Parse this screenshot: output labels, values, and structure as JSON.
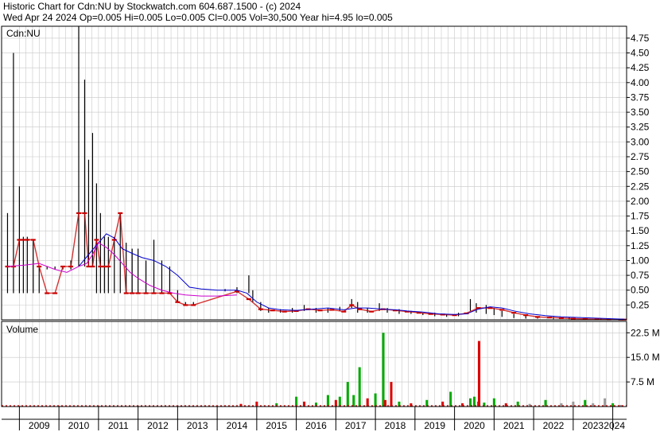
{
  "header": {
    "title_line": "Historic Chart for Cdn:NU by Stockwatch.com 604.687.1500 - (c) 2024",
    "summary_line": "Wed Apr 24 2024   Op=0.005  Hi=0.005  Lo=0.005  Cl=0.005  Vol=30,500  Year hi=4.95  lo=0.005"
  },
  "chart_data": [
    {
      "type": "line",
      "title": "Cdn:NU",
      "ylim": [
        0,
        4.95
      ],
      "y_ticks": [
        "0.25",
        "0.50",
        "0.75",
        "1.00",
        "1.25",
        "1.50",
        "1.75",
        "2.00",
        "2.25",
        "2.50",
        "2.75",
        "3.00",
        "3.25",
        "3.50",
        "3.75",
        "4.00",
        "4.25",
        "4.50",
        "4.75"
      ],
      "x_ticks": [
        "2009",
        "2010",
        "2011",
        "2012",
        "2013",
        "2014",
        "2015",
        "2016",
        "2017",
        "2018",
        "2019",
        "2020",
        "2021",
        "2022",
        "2023",
        "2024"
      ],
      "grid": true,
      "series": [
        {
          "kind": "price-bars",
          "color": "#000000",
          "x": [
            2008.7,
            2008.85,
            2009.0,
            2009.1,
            2009.2,
            2009.35,
            2009.5,
            2009.7,
            2009.9,
            2010.1,
            2010.3,
            2010.5,
            2010.65,
            2010.75,
            2010.85,
            2010.95,
            2011.05,
            2011.15,
            2011.25,
            2011.4,
            2011.55,
            2011.7,
            2011.85,
            2012.0,
            2012.2,
            2012.4,
            2012.6,
            2012.8,
            2013.0,
            2013.2,
            2013.4,
            2014.2,
            2014.5,
            2014.8,
            2014.9,
            2015.1,
            2015.3,
            2015.6,
            2015.9,
            2016.2,
            2016.5,
            2016.8,
            2017.1,
            2017.4,
            2017.55,
            2017.8,
            2018.1,
            2018.3,
            2018.6,
            2018.9,
            2019.2,
            2019.5,
            2019.8,
            2020.1,
            2020.4,
            2020.55,
            2020.8,
            2021.0,
            2021.2,
            2021.5,
            2021.8,
            2022.1,
            2022.5,
            2022.9,
            2023.3,
            2023.7,
            2024.1,
            2024.3
          ],
          "high": [
            1.8,
            4.5,
            2.25,
            1.4,
            1.4,
            1.35,
            0.9,
            0.9,
            0.9,
            0.9,
            1.0,
            4.95,
            4.05,
            2.7,
            3.15,
            2.3,
            1.8,
            1.4,
            1.4,
            1.4,
            1.8,
            1.3,
            1.2,
            1.2,
            1.0,
            1.35,
            1.0,
            0.9,
            0.5,
            0.3,
            0.3,
            0.52,
            0.55,
            0.75,
            0.5,
            0.3,
            0.2,
            0.18,
            0.2,
            0.25,
            0.2,
            0.2,
            0.22,
            0.35,
            0.3,
            0.2,
            0.28,
            0.2,
            0.18,
            0.15,
            0.12,
            0.12,
            0.1,
            0.12,
            0.35,
            0.28,
            0.25,
            0.2,
            0.15,
            0.1,
            0.08,
            0.06,
            0.05,
            0.04,
            0.03,
            0.02,
            0.01,
            0.005
          ],
          "low": [
            0.45,
            0.45,
            0.45,
            0.45,
            0.45,
            0.45,
            0.45,
            0.85,
            0.85,
            0.85,
            0.85,
            0.9,
            0.9,
            0.9,
            0.9,
            0.45,
            0.45,
            0.45,
            0.45,
            0.45,
            0.45,
            0.45,
            0.45,
            0.45,
            0.45,
            0.45,
            0.45,
            0.45,
            0.3,
            0.25,
            0.25,
            0.48,
            0.45,
            0.45,
            0.3,
            0.15,
            0.12,
            0.12,
            0.12,
            0.15,
            0.12,
            0.12,
            0.15,
            0.2,
            0.12,
            0.12,
            0.15,
            0.12,
            0.1,
            0.1,
            0.08,
            0.06,
            0.05,
            0.06,
            0.15,
            0.12,
            0.1,
            0.08,
            0.05,
            0.03,
            0.02,
            0.02,
            0.01,
            0.01,
            0.005,
            0.005,
            0.005,
            0.005
          ]
        },
        {
          "kind": "price-close",
          "color": "#cc0000",
          "x": [
            2008.7,
            2008.85,
            2009.0,
            2009.1,
            2009.2,
            2009.35,
            2009.5,
            2009.7,
            2009.9,
            2010.1,
            2010.3,
            2010.5,
            2010.65,
            2010.75,
            2010.85,
            2010.95,
            2011.05,
            2011.15,
            2011.25,
            2011.4,
            2011.55,
            2011.7,
            2011.85,
            2012.0,
            2012.2,
            2012.4,
            2012.6,
            2012.8,
            2013.0,
            2013.2,
            2013.4,
            2014.5,
            2014.8,
            2015.1,
            2015.4,
            2015.7,
            2016.0,
            2016.3,
            2016.6,
            2016.9,
            2017.2,
            2017.4,
            2017.6,
            2017.9,
            2018.2,
            2018.5,
            2018.8,
            2019.1,
            2019.4,
            2019.7,
            2020.0,
            2020.3,
            2020.6,
            2020.9,
            2021.2,
            2021.5,
            2021.8,
            2022.1,
            2022.4,
            2022.7,
            2023.0,
            2023.3,
            2023.6,
            2023.9,
            2024.2,
            2024.3
          ],
          "y": [
            0.9,
            0.9,
            1.35,
            1.35,
            1.35,
            1.35,
            0.9,
            0.45,
            0.45,
            0.9,
            0.9,
            1.8,
            1.8,
            0.9,
            0.9,
            1.35,
            0.9,
            0.9,
            0.9,
            1.35,
            1.8,
            0.45,
            0.45,
            0.45,
            0.45,
            0.45,
            0.45,
            0.45,
            0.3,
            0.25,
            0.25,
            0.48,
            0.35,
            0.18,
            0.16,
            0.14,
            0.15,
            0.18,
            0.16,
            0.17,
            0.14,
            0.25,
            0.18,
            0.14,
            0.18,
            0.16,
            0.14,
            0.12,
            0.1,
            0.09,
            0.08,
            0.11,
            0.2,
            0.2,
            0.17,
            0.12,
            0.08,
            0.05,
            0.04,
            0.03,
            0.02,
            0.015,
            0.01,
            0.008,
            0.005,
            0.005
          ]
        },
        {
          "kind": "moving-average",
          "color": "#0000cc",
          "x": [
            2010.5,
            2010.75,
            2011.0,
            2011.2,
            2011.4,
            2011.6,
            2011.85,
            2012.1,
            2012.4,
            2012.7,
            2013.0,
            2013.3,
            2013.6,
            2014.0,
            2014.5,
            2014.75,
            2015.0,
            2015.3,
            2015.6,
            2016.0,
            2016.4,
            2016.8,
            2017.2,
            2017.5,
            2017.8,
            2018.2,
            2018.5,
            2018.8,
            2019.2,
            2019.6,
            2020.0,
            2020.3,
            2020.6,
            2020.9,
            2021.2,
            2021.5,
            2021.9,
            2022.3,
            2022.7,
            2023.1,
            2023.5,
            2023.9,
            2024.3
          ],
          "y": [
            0.9,
            1.1,
            1.3,
            1.45,
            1.38,
            1.2,
            1.12,
            1.05,
            1.0,
            0.9,
            0.75,
            0.55,
            0.52,
            0.5,
            0.5,
            0.45,
            0.3,
            0.2,
            0.17,
            0.16,
            0.18,
            0.2,
            0.17,
            0.2,
            0.2,
            0.18,
            0.17,
            0.15,
            0.13,
            0.1,
            0.09,
            0.1,
            0.18,
            0.22,
            0.2,
            0.15,
            0.1,
            0.07,
            0.05,
            0.04,
            0.03,
            0.02,
            0.01
          ]
        },
        {
          "kind": "moving-average",
          "color": "#cc00cc",
          "x": [
            2008.7,
            2009.1,
            2009.5,
            2009.9,
            2010.2,
            2010.5,
            2010.7,
            2010.85,
            2011.0,
            2011.2,
            2011.4,
            2011.6,
            2011.8,
            2012.0,
            2012.3,
            2012.6,
            2012.9,
            2013.2,
            2013.6,
            2014.0,
            2014.5
          ],
          "y": [
            0.9,
            0.92,
            0.95,
            0.85,
            0.8,
            0.9,
            0.95,
            1.1,
            1.3,
            1.22,
            1.1,
            0.95,
            0.8,
            0.7,
            0.58,
            0.5,
            0.45,
            0.42,
            0.4,
            0.4,
            0.42
          ]
        }
      ]
    },
    {
      "type": "bar",
      "title": "Volume",
      "ylim": [
        0,
        25
      ],
      "y_ticks": [
        "7.5 M",
        "15.0 M",
        "22.5 M"
      ],
      "x_ticks": [
        "2009",
        "2010",
        "2011",
        "2012",
        "2013",
        "2014",
        "2015",
        "2016",
        "2017",
        "2018",
        "2019",
        "2020",
        "2021",
        "2022",
        "2023",
        "2024"
      ],
      "colors": {
        "up": "#00aa00",
        "down": "#dd0000",
        "flat": "#999999"
      },
      "bars": {
        "x": [
          2009.0,
          2010.0,
          2011.0,
          2012.0,
          2013.0,
          2014.0,
          2014.6,
          2015.0,
          2015.5,
          2016.0,
          2016.2,
          2016.5,
          2016.8,
          2017.0,
          2017.1,
          2017.3,
          2017.45,
          2017.6,
          2017.8,
          2018.0,
          2018.2,
          2018.25,
          2018.4,
          2018.6,
          2018.9,
          2019.3,
          2019.7,
          2019.9,
          2020.2,
          2020.4,
          2020.5,
          2020.6,
          2020.62,
          2020.75,
          2021.0,
          2021.3,
          2021.6,
          2021.9,
          2022.3,
          2022.7,
          2023.0,
          2023.3,
          2023.5,
          2023.8,
          2024.0,
          2024.2
        ],
        "volume": [
          0.3,
          0.3,
          0.3,
          0.3,
          0.3,
          0.2,
          0.8,
          1.5,
          1.0,
          3.0,
          1.5,
          1.2,
          3.5,
          2.0,
          3.0,
          7.5,
          3.5,
          12.0,
          2.5,
          4.0,
          22.5,
          2.0,
          7.5,
          1.5,
          1.0,
          2.0,
          1.5,
          4.5,
          1.0,
          2.5,
          3.0,
          1.5,
          20.0,
          1.2,
          2.5,
          1.0,
          1.5,
          0.8,
          2.0,
          1.0,
          1.5,
          2.0,
          1.0,
          2.5,
          1.0,
          0.5
        ],
        "direction": [
          "flat",
          "flat",
          "flat",
          "flat",
          "flat",
          "flat",
          "down",
          "down",
          "up",
          "up",
          "down",
          "up",
          "up",
          "down",
          "up",
          "up",
          "up",
          "up",
          "down",
          "up",
          "up",
          "down",
          "down",
          "up",
          "down",
          "up",
          "down",
          "up",
          "down",
          "up",
          "up",
          "up",
          "down",
          "up",
          "up",
          "down",
          "up",
          "flat",
          "up",
          "flat",
          "flat",
          "up",
          "flat",
          "flat",
          "up",
          "flat"
        ]
      }
    }
  ]
}
